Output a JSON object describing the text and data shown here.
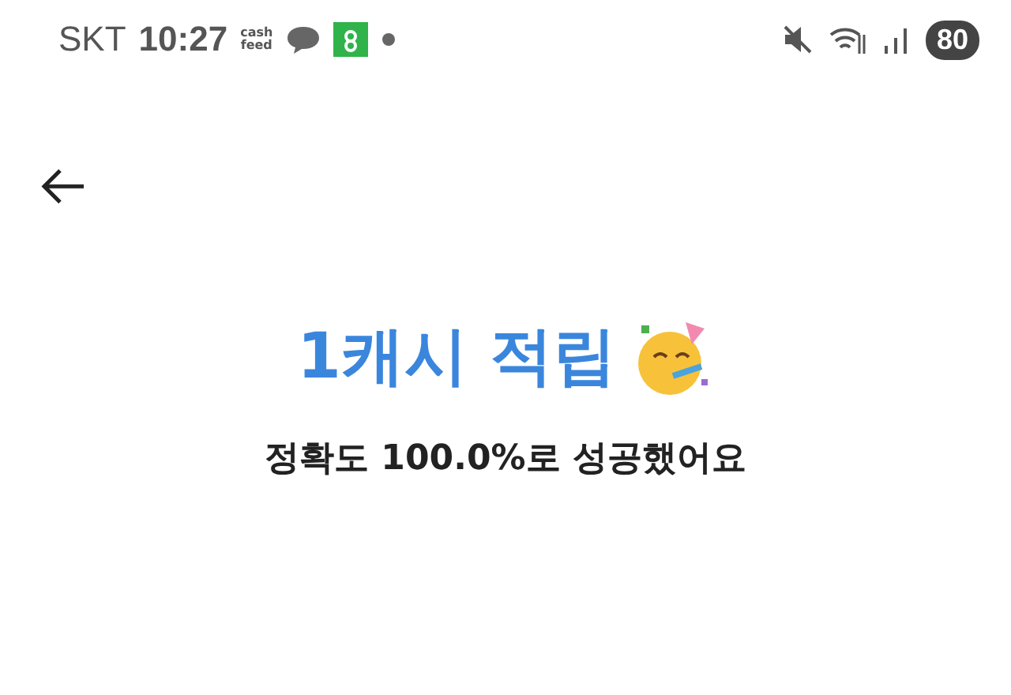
{
  "status_bar": {
    "carrier": "SKT",
    "time": "10:27",
    "app_badge": [
      "cash",
      "feed"
    ],
    "battery": "80"
  },
  "title": "1캐시 적립",
  "message": "정확도 100.0%로 성공했어요"
}
